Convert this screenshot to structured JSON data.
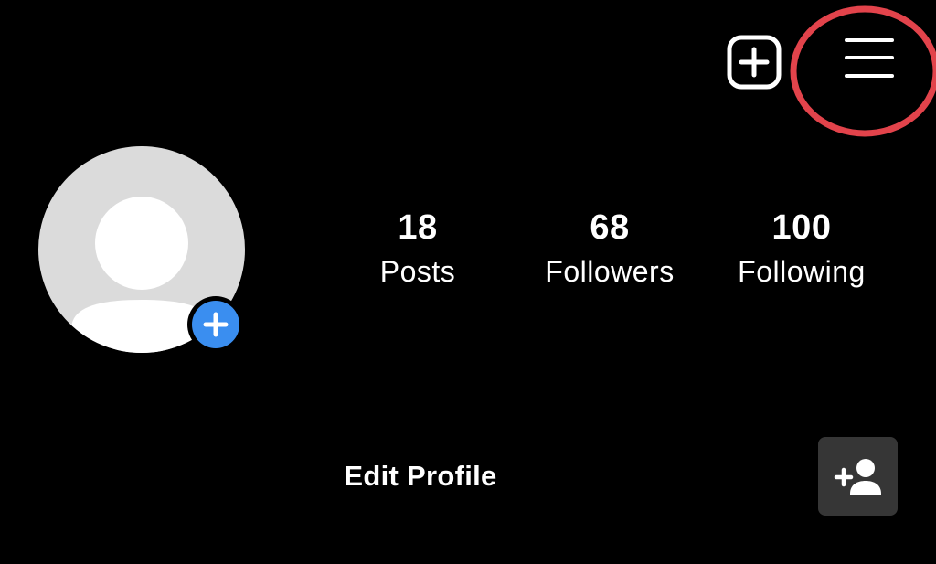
{
  "header": {
    "new_post_icon": "plus-square-icon",
    "menu_icon": "hamburger-menu-icon"
  },
  "annotation": {
    "ring_color": "#e2434b"
  },
  "profile": {
    "avatar_icon": "default-avatar-icon",
    "add_story_icon": "plus-icon",
    "add_story_color": "#3a8ef0"
  },
  "stats": {
    "posts": {
      "count": "18",
      "label": "Posts"
    },
    "followers": {
      "count": "68",
      "label": "Followers"
    },
    "following": {
      "count": "100",
      "label": "Following"
    }
  },
  "actions": {
    "edit_profile_label": "Edit Profile",
    "discover_people_icon": "add-person-icon"
  }
}
